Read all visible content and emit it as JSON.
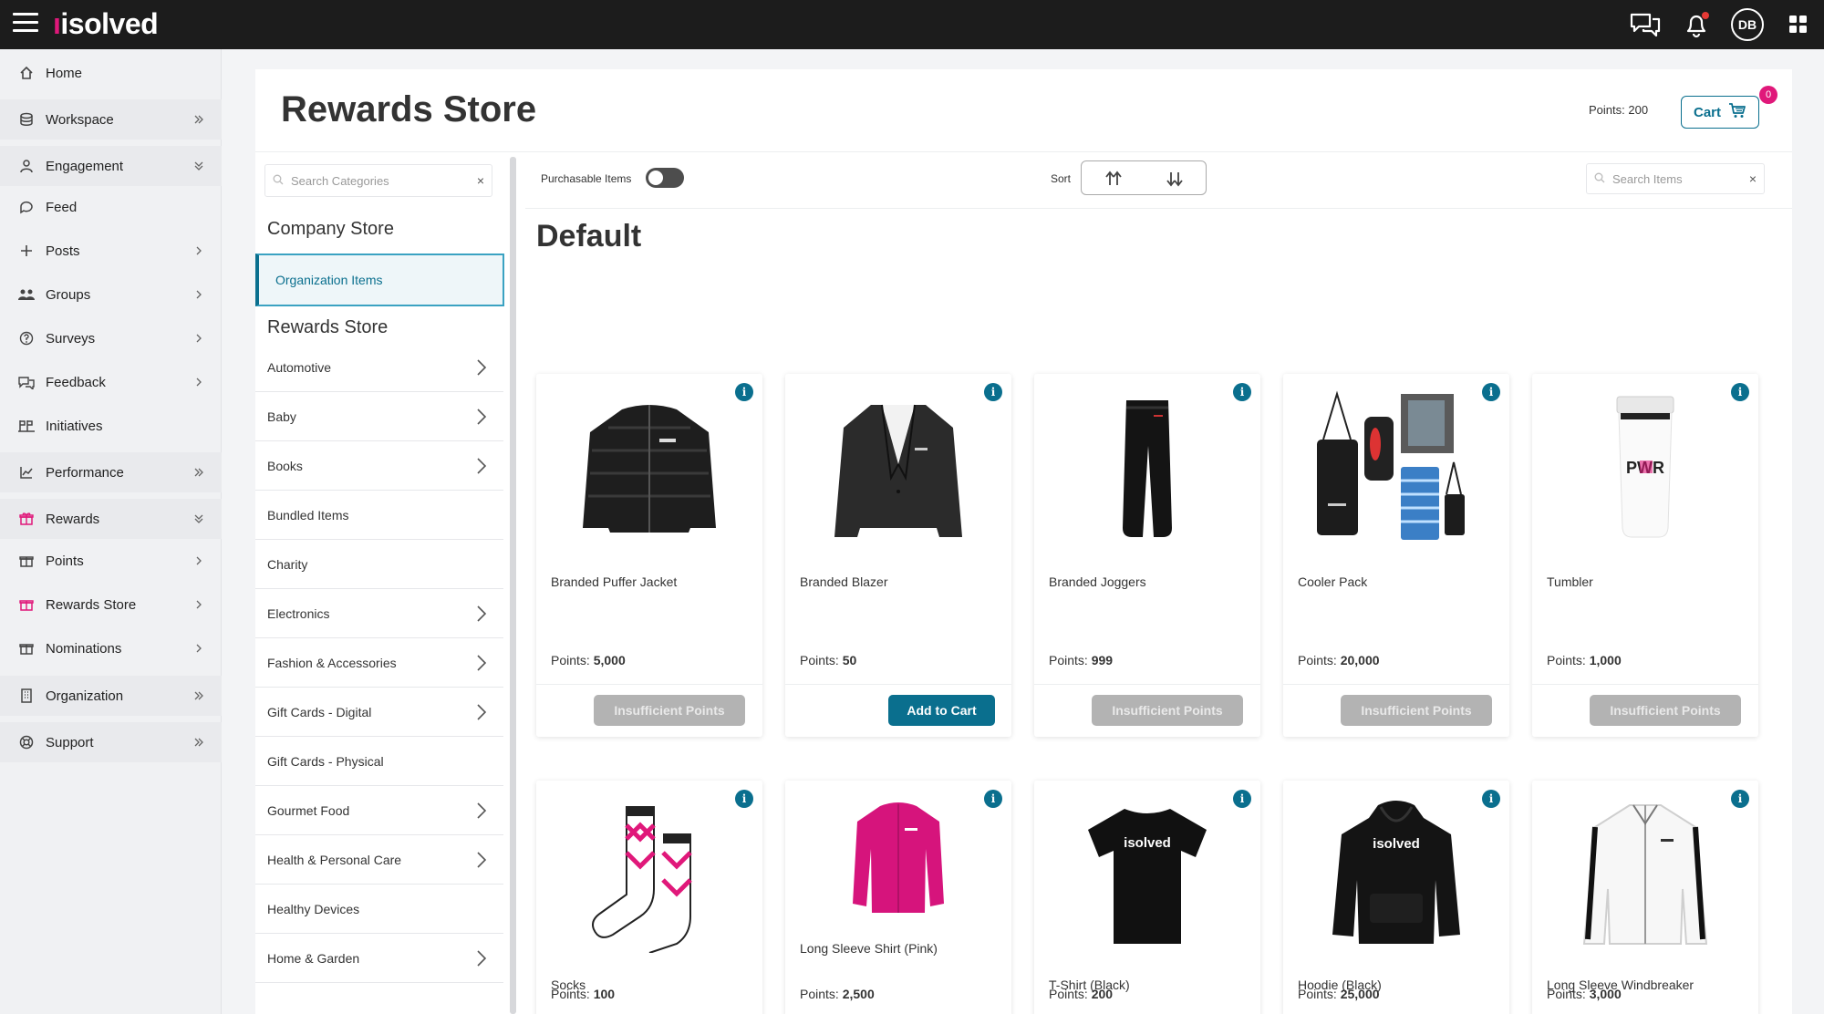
{
  "topbar": {
    "brand": "isolved",
    "avatar_initials": "DB",
    "icons": [
      "menu-icon",
      "chat-icon",
      "bell-icon",
      "apps-grid-icon"
    ]
  },
  "sidebar": {
    "items": [
      {
        "label": "Home",
        "icon": "home-icon"
      },
      {
        "label": "Workspace",
        "icon": "layers-icon"
      },
      {
        "label": "Engagement",
        "icon": "user-icon"
      },
      {
        "label": "Feed",
        "icon": "comment-icon"
      },
      {
        "label": "Posts",
        "icon": "plus-icon"
      },
      {
        "label": "Groups",
        "icon": "groups-icon"
      },
      {
        "label": "Surveys",
        "icon": "question-icon"
      },
      {
        "label": "Feedback",
        "icon": "feedback-icon"
      },
      {
        "label": "Initiatives",
        "icon": "initiatives-icon"
      },
      {
        "label": "Performance",
        "icon": "chart-icon"
      },
      {
        "label": "Rewards",
        "icon": "gift-icon"
      },
      {
        "label": "Points",
        "icon": "gift-icon"
      },
      {
        "label": "Rewards Store",
        "icon": "gift-icon"
      },
      {
        "label": "Nominations",
        "icon": "gift-icon"
      },
      {
        "label": "Organization",
        "icon": "building-icon"
      },
      {
        "label": "Support",
        "icon": "lifebuoy-icon"
      }
    ]
  },
  "header": {
    "title": "Rewards Store",
    "points": "Points: 200",
    "cart_label": "Cart",
    "cart_count": "0"
  },
  "categories": {
    "search_placeholder": "Search Categories",
    "company_store": "Company Store",
    "selected": "Organization Items",
    "rewards_store": "Rewards Store",
    "items": [
      "Automotive",
      "Baby",
      "Books",
      "Bundled Items",
      "Charity",
      "Electronics",
      "Fashion & Accessories",
      "Gift Cards - Digital",
      "Gift Cards - Physical",
      "Gourmet Food",
      "Health & Personal Care",
      "Healthy Devices",
      "Home & Garden"
    ]
  },
  "toolbar": {
    "purchasable_label": "Purchasable Items",
    "purchasable_on": false,
    "sort_label": "Sort",
    "search_placeholder": "Search Items"
  },
  "section_title": "Default",
  "products": [
    {
      "name": "Branded Puffer Jacket",
      "points": "5,000",
      "button": "Insufficient Points"
    },
    {
      "name": "Branded Blazer",
      "points": "50",
      "button": "Add to Cart"
    },
    {
      "name": "Branded Joggers",
      "points": "999",
      "button": "Insufficient Points"
    },
    {
      "name": "Cooler Pack",
      "points": "20,000",
      "button": "Insufficient Points"
    },
    {
      "name": "Tumbler",
      "points": "1,000",
      "button": "Insufficient Points"
    },
    {
      "name": "Socks",
      "points": "100"
    },
    {
      "name": "Long Sleeve Shirt (Pink)",
      "points": "2,500"
    },
    {
      "name": "T-Shirt (Black)",
      "points": "200"
    },
    {
      "name": "Hoodie (Black)",
      "points": "25,000"
    },
    {
      "name": "Long Sleeve Windbreaker",
      "points": "3,000"
    }
  ],
  "labels": {
    "points_prefix": "Points:",
    "info": "i",
    "tumbler_print": "PWR",
    "shirt_print": "isolved"
  },
  "colors": {
    "accent": "#0a6f8e",
    "brand_pink": "#e0187a",
    "disabled": "#b3b3b3"
  }
}
